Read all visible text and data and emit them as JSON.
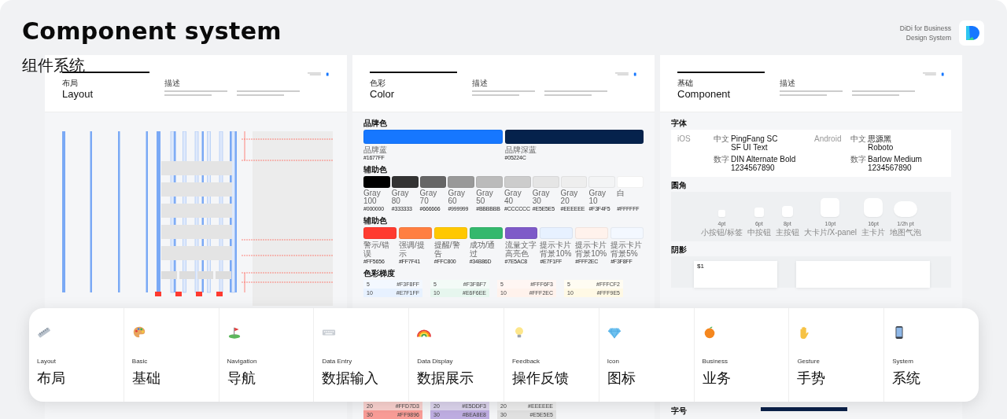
{
  "header": {
    "title": "Component system",
    "subtitle": "组件系统",
    "brand_line_1": "DiDi for Business",
    "brand_line_2": "Design System"
  },
  "boards": [
    {
      "kind": "layout",
      "title_cn": "布局",
      "title_en": "Layout",
      "desc_label": "描述"
    },
    {
      "kind": "color",
      "title_cn": "色彩",
      "title_en": "Color",
      "desc_label": "描述",
      "brand": {
        "heading": "品牌色",
        "swatches": [
          {
            "name": "品牌蓝",
            "code": "#1677FF",
            "color": "#1677ff"
          },
          {
            "name": "品牌深蓝",
            "code": "#05224C",
            "color": "#05224c"
          }
        ]
      },
      "grays": {
        "heading": "辅助色",
        "swatches": [
          {
            "name": "Gray 100",
            "code": "#000000",
            "color": "#000000"
          },
          {
            "name": "Gray 80",
            "code": "#333333",
            "color": "#333333"
          },
          {
            "name": "Gray 70",
            "code": "#666666",
            "color": "#666666"
          },
          {
            "name": "Gray 60",
            "code": "#999999",
            "color": "#999999"
          },
          {
            "name": "Gray 50",
            "code": "#BBBBBB",
            "color": "#bbbbbb"
          },
          {
            "name": "Gray 40",
            "code": "#CCCCCC",
            "color": "#cccccc"
          },
          {
            "name": "Gray 30",
            "code": "#E5E5E5",
            "color": "#e5e5e5"
          },
          {
            "name": "Gray 20",
            "code": "#EEEEEE",
            "color": "#eeeeee"
          },
          {
            "name": "Gray 10",
            "code": "#F3F4F5",
            "color": "#f3f4f5"
          },
          {
            "name": "白",
            "code": "#FFFFFF",
            "color": "#ffffff"
          }
        ]
      },
      "accents": {
        "heading": "辅助色",
        "swatches": [
          {
            "name": "警示/错误",
            "code": "#FF5656",
            "color": "#ff3b30"
          },
          {
            "name": "强调/提示",
            "code": "#FF7F41",
            "color": "#ff7f41"
          },
          {
            "name": "提醒/警告",
            "code": "#FFC800",
            "color": "#ffc800"
          },
          {
            "name": "成功/通过",
            "code": "#34B86D",
            "color": "#34b86d"
          },
          {
            "name": "流量文字高亮色",
            "code": "#7E5AC8",
            "color": "#7e5ac8"
          },
          {
            "name": "提示卡片背景10%",
            "code": "#E7F1FF",
            "color": "#e7f1ff"
          },
          {
            "name": "提示卡片背景10%",
            "code": "#FFF2EC",
            "color": "#fff2ec"
          },
          {
            "name": "提示卡片背景5%",
            "code": "#F3F8FF",
            "color": "#f3f8ff"
          }
        ]
      },
      "gradient": {
        "heading": "色彩梯度",
        "top": [
          [
            {
              "step": "5",
              "code": "#F3F8FF",
              "color": "#f3f8ff"
            },
            {
              "step": "10",
              "code": "#E7F1FF",
              "color": "#e7f1ff"
            }
          ],
          [
            {
              "step": "5",
              "code": "#F3FBF7",
              "color": "#f3fbf7"
            },
            {
              "step": "10",
              "code": "#E6F6EE",
              "color": "#e6f6ee"
            }
          ],
          [
            {
              "step": "5",
              "code": "#FFF6F3",
              "color": "#fff6f3"
            },
            {
              "step": "10",
              "code": "#FFF2EC",
              "color": "#fff2ec"
            }
          ],
          [
            {
              "step": "5",
              "code": "#FFFCF2",
              "color": "#fffcf2"
            },
            {
              "step": "10",
              "code": "#FFF9E5",
              "color": "#fff9e5"
            }
          ]
        ],
        "bottom": [
          [
            {
              "step": "20",
              "code": "#FFD7D3",
              "color": "#fad2cf"
            },
            {
              "step": "30",
              "code": "#FF9896",
              "color": "#fa9d97"
            }
          ],
          [
            {
              "step": "20",
              "code": "#E5DDF3",
              "color": "#ddd5ee"
            },
            {
              "step": "30",
              "code": "#BEA8E8",
              "color": "#bfaee2"
            }
          ],
          [
            {
              "step": "20",
              "code": "#EEEEEE",
              "color": "#eeeeee"
            },
            {
              "step": "30",
              "code": "#E5E5E5",
              "color": "#e2e2e2"
            }
          ]
        ]
      }
    },
    {
      "kind": "component",
      "title_cn": "基础",
      "title_en": "Component",
      "desc_label": "描述",
      "fonts": {
        "heading": "字体",
        "platforms": [
          {
            "name": "iOS",
            "cn_label": "中文",
            "cn_fonts": [
              "PingFang SC",
              "SF UI Text"
            ],
            "num_label": "数字",
            "num_font": "DIN Alternate Bold 1234567890"
          },
          {
            "name": "Android",
            "cn_label": "中文",
            "cn_fonts": [
              "思源黑",
              "Roboto"
            ],
            "num_label": "数字",
            "num_font": "Barlow Medium 1234567890"
          }
        ]
      },
      "radius": {
        "heading": "圆角",
        "items": [
          {
            "value": "4pt",
            "use": "小按钮/标签"
          },
          {
            "value": "6pt",
            "use": "中按钮"
          },
          {
            "value": "8pt",
            "use": "主按钮"
          },
          {
            "value": "10pt",
            "use": "大卡片/X-panel"
          },
          {
            "value": "16pt",
            "use": "主卡片"
          },
          {
            "value": "1/2h pt",
            "use": "地图气泡"
          }
        ]
      },
      "shadow": {
        "heading": "阴影",
        "card_text": "$1"
      },
      "type_heading": "字号"
    }
  ],
  "nav": [
    {
      "en": "Layout",
      "cn": "布局"
    },
    {
      "en": "Basic",
      "cn": "基础"
    },
    {
      "en": "Navigation",
      "cn": "导航"
    },
    {
      "en": "Data Entry",
      "cn": "数据输入"
    },
    {
      "en": "Data Display",
      "cn": "数据展示"
    },
    {
      "en": "Feedback",
      "cn": "操作反馈"
    },
    {
      "en": "Icon",
      "cn": "图标"
    },
    {
      "en": "Business",
      "cn": "业务"
    },
    {
      "en": "Gesture",
      "cn": "手势"
    },
    {
      "en": "System",
      "cn": "系统"
    }
  ]
}
